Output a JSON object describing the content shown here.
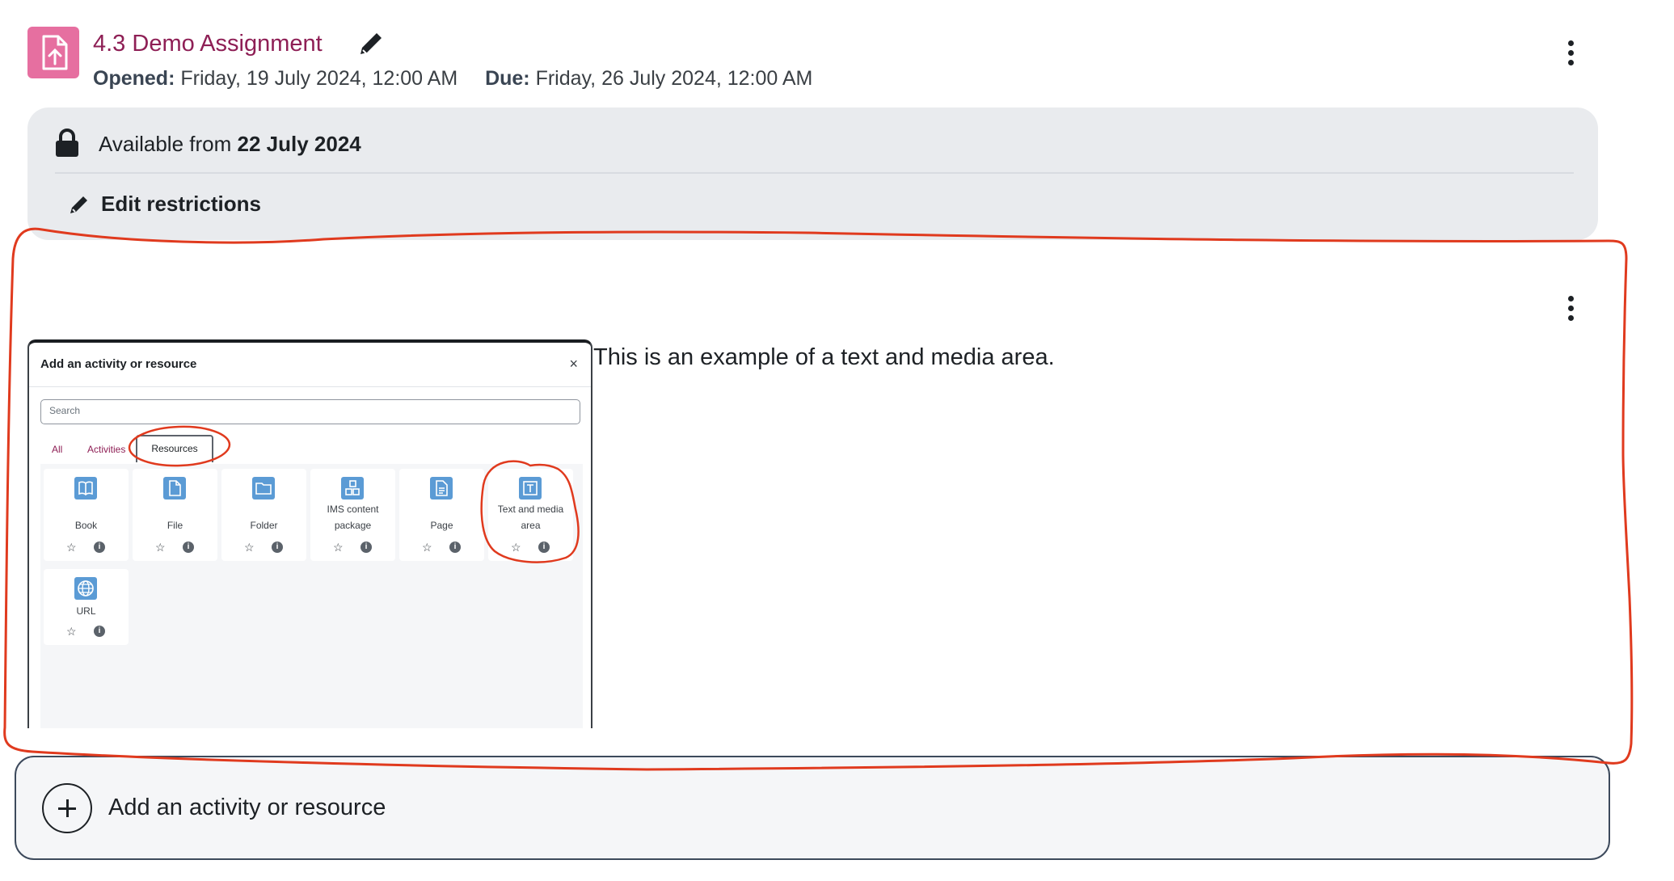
{
  "assignment": {
    "title": "4.3 Demo Assignment",
    "icon": "assignment-upload-icon",
    "icon_color": "#e66fa0",
    "title_color": "#8e1f55",
    "opened_label": "Opened:",
    "opened_value": "Friday, 19 July 2024, 12:00 AM",
    "due_label": "Due:",
    "due_value": "Friday, 26 July 2024, 12:00 AM"
  },
  "restrictions": {
    "available_prefix": "Available from",
    "available_date": "22 July 2024",
    "edit_label": "Edit restrictions"
  },
  "text_media": {
    "text": "This is an example of a text and media area."
  },
  "modal": {
    "title": "Add an activity or resource",
    "close": "×",
    "search_placeholder": "Search",
    "tabs": [
      "All",
      "Activities",
      "Resources"
    ],
    "active_tab": "Resources",
    "items": [
      {
        "label": "Book",
        "icon": "book-icon"
      },
      {
        "label": "File",
        "icon": "file-icon"
      },
      {
        "label": "Folder",
        "icon": "folder-icon"
      },
      {
        "label": "IMS content package",
        "icon": "ims-package-icon"
      },
      {
        "label": "Page",
        "icon": "page-icon"
      },
      {
        "label": "Text and media area",
        "icon": "text-media-icon"
      },
      {
        "label": "URL",
        "icon": "url-globe-icon"
      }
    ],
    "star": "☆",
    "info": "i"
  },
  "add_activity": {
    "label": "Add an activity or resource"
  },
  "colors": {
    "accent": "#8e1f55",
    "restriction_bg": "#e9ebee",
    "annotation": "#e03a1e",
    "resource_icon": "#5b9bd5"
  }
}
